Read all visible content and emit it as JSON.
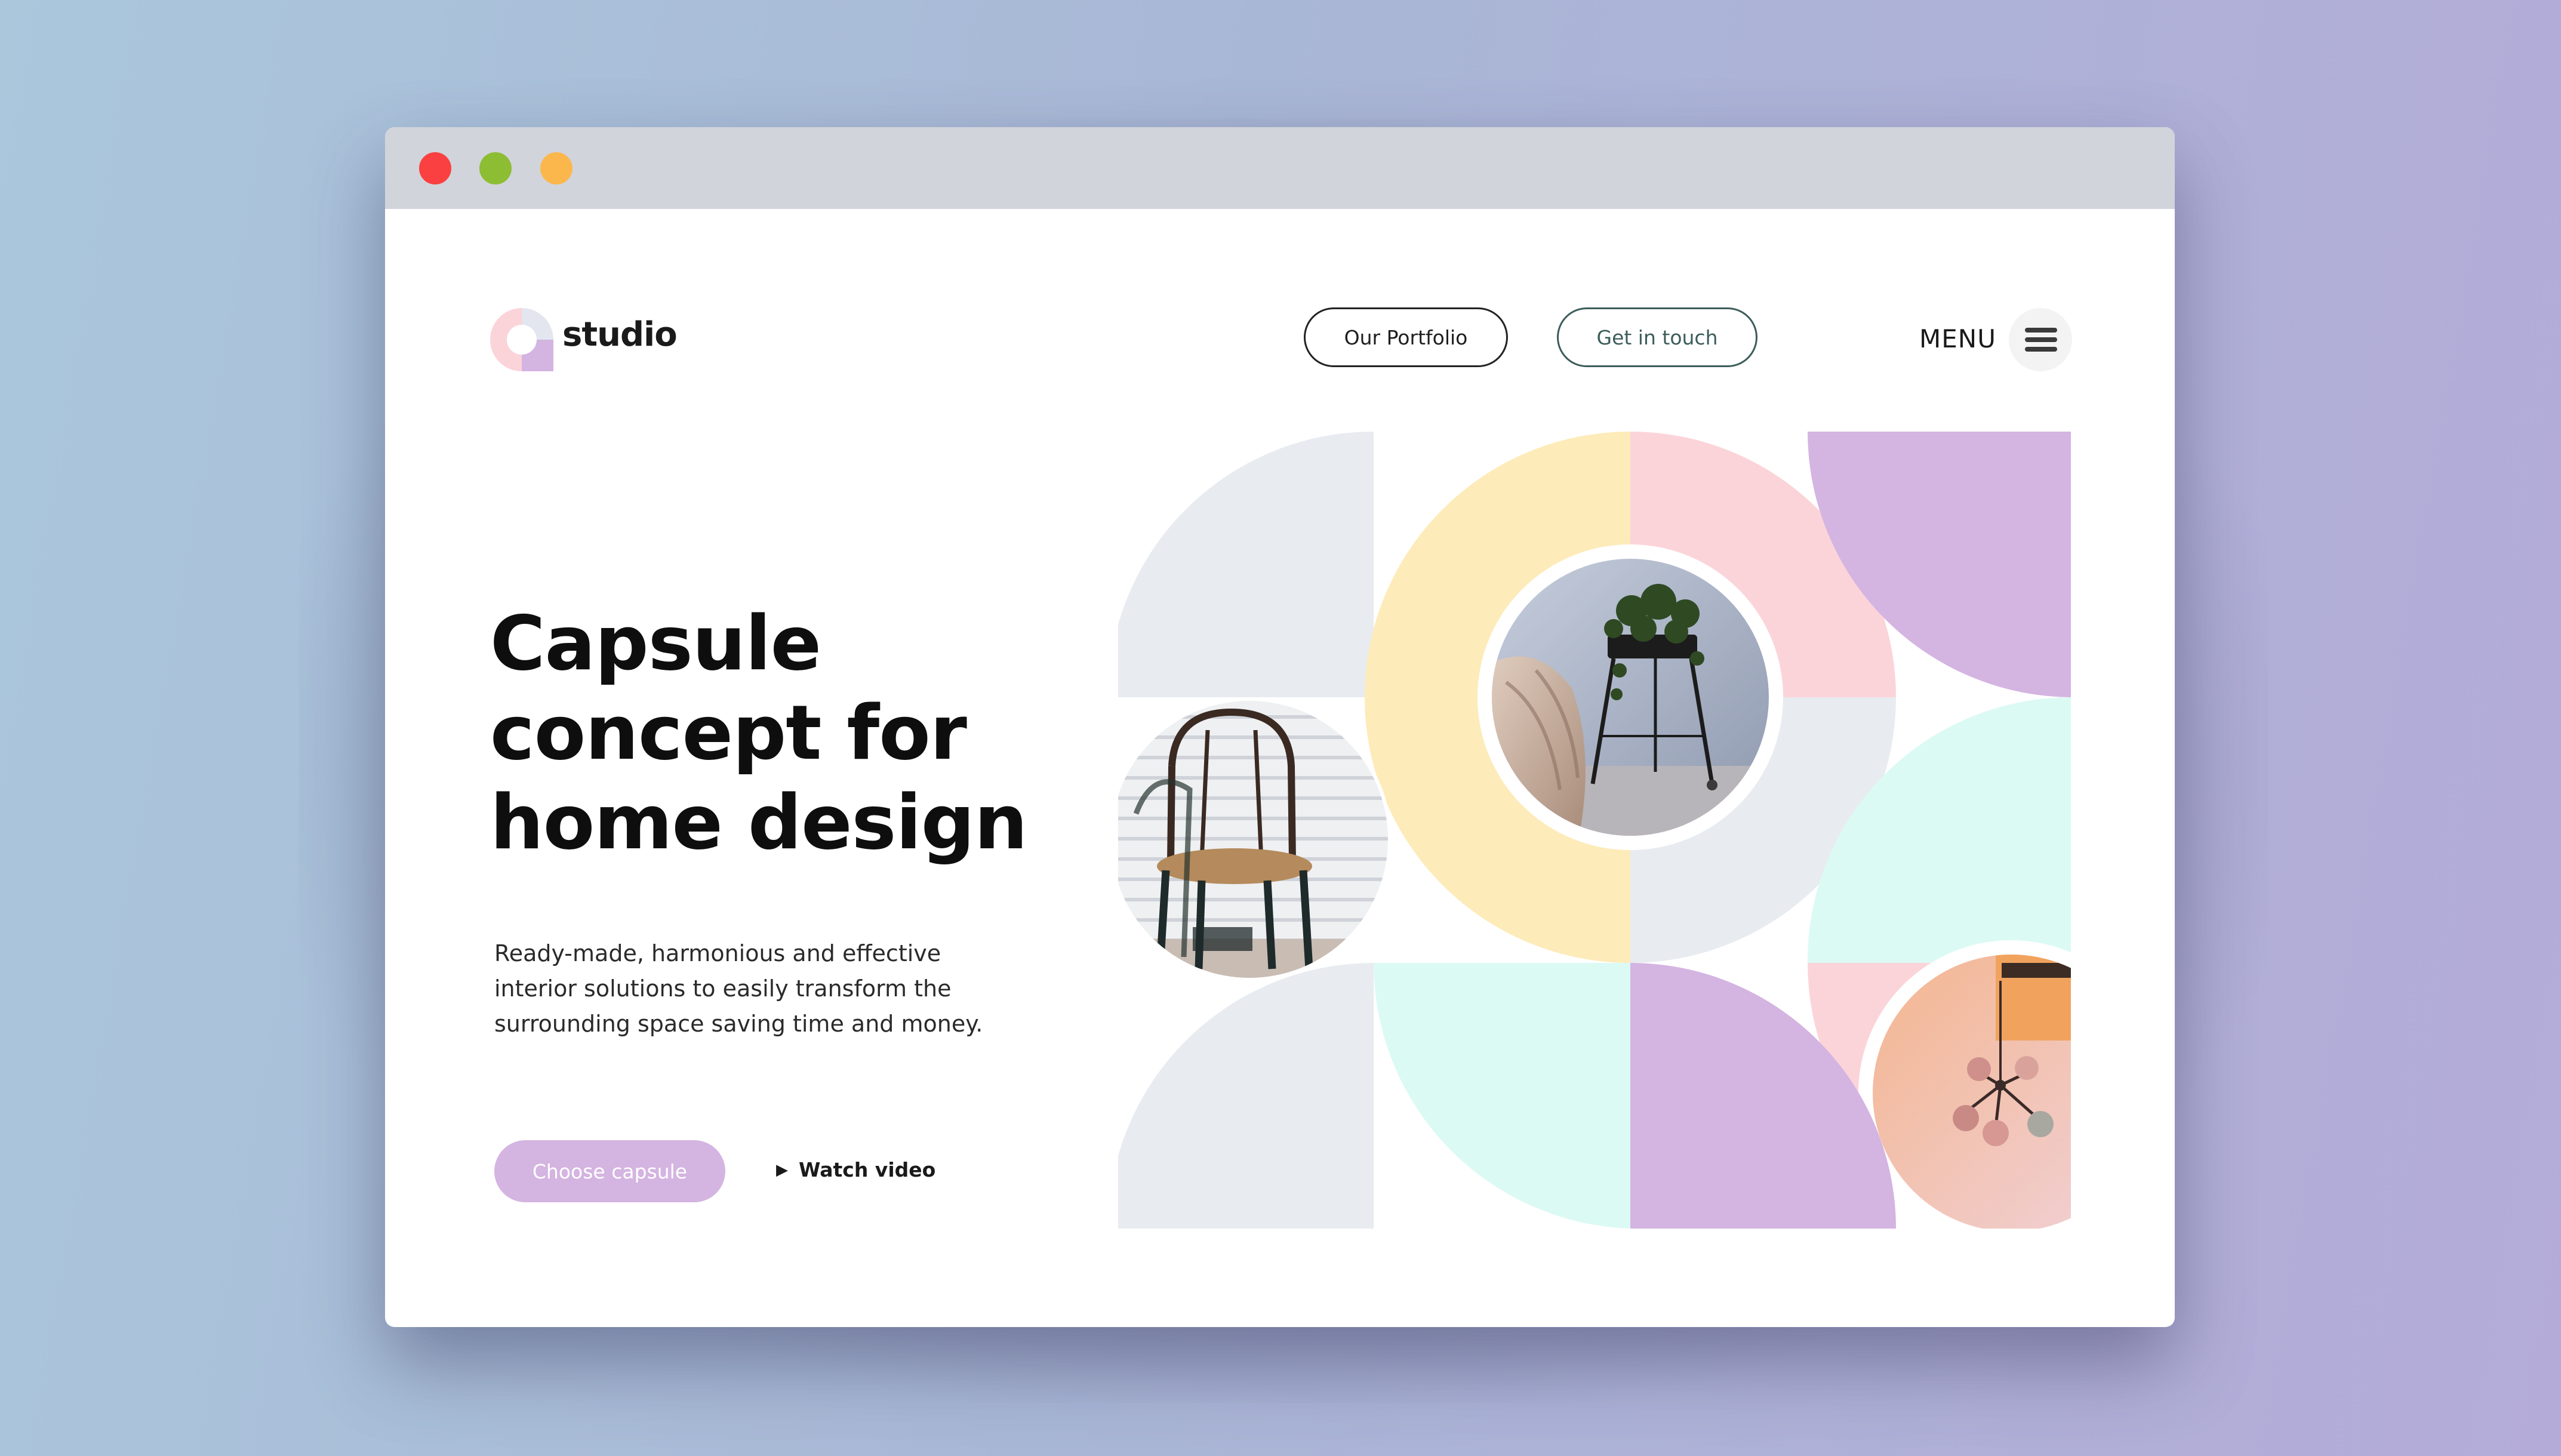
{
  "window": {
    "controls": [
      "close",
      "maximize",
      "minimize"
    ],
    "colors": {
      "close": "#fa4040",
      "maximize": "#8dbd33",
      "minimize": "#fbb74c"
    }
  },
  "header": {
    "brand": "studio",
    "portfolio_label": "Our Portfolio",
    "contact_label": "Get in touch",
    "menu_label": "MENU"
  },
  "hero": {
    "title_lines": [
      "Capsule",
      "concept for",
      "home design"
    ],
    "description_lines": [
      "Ready-made, harmonious and effective",
      "interior solutions to easily transform the",
      "surrounding space  saving time and money."
    ],
    "primary_cta": "Choose capsule",
    "video_link": "Watch video",
    "play_icon": "▶"
  },
  "colors": {
    "lavender": "#d4b4e1",
    "pink": "#fbd4d9",
    "yellow": "#fdebb9",
    "gray": "#e8ebf0",
    "mint": "#dcfaf4",
    "accent_green": "#3c5c5a"
  },
  "gallery": {
    "images": [
      "chair-photo",
      "plant-stand-photo",
      "pendant-lamp-photo"
    ]
  }
}
